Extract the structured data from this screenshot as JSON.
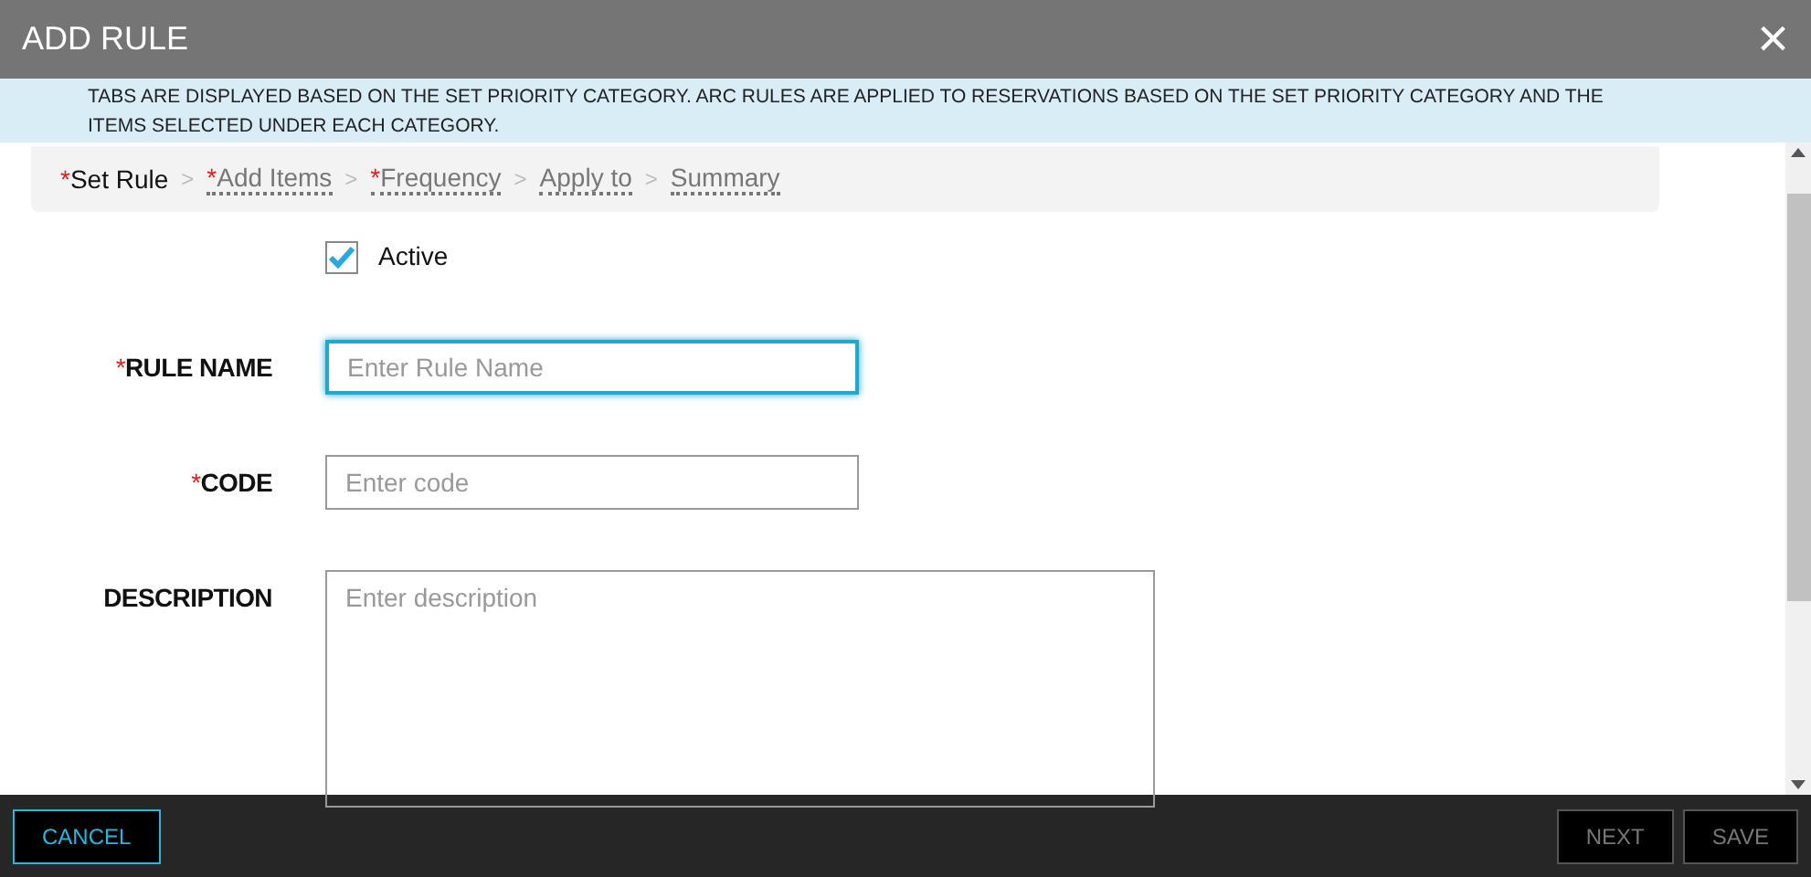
{
  "window": {
    "title": "ADD RULE",
    "close": "×"
  },
  "info": "TABS ARE DISPLAYED BASED ON THE SET PRIORITY CATEGORY. ARC RULES ARE APPLIED TO RESERVATIONS BASED ON THE SET PRIORITY CATEGORY AND THE ITEMS SELECTED UNDER EACH CATEGORY.",
  "steps": [
    {
      "mark": "*",
      "label": "Set Rule",
      "selected": true
    },
    {
      "mark": "*",
      "label": "Add Items",
      "selected": false
    },
    {
      "mark": "*",
      "label": "Frequency",
      "selected": false
    },
    {
      "label": "Apply to",
      "selected": false
    },
    {
      "label": "Summary",
      "selected": false
    }
  ],
  "step_separator": ">",
  "fields": [
    {
      "kind": "checkbox",
      "label": "Active",
      "checked": true
    },
    {
      "kind": "text",
      "mark": "*",
      "label": "RULE NAME",
      "placeholder": "Enter Rule Name",
      "focused": true
    },
    {
      "kind": "text",
      "mark": "*",
      "label": "CODE",
      "placeholder": "Enter code",
      "focused": false
    },
    {
      "kind": "textarea",
      "label": "DESCRIPTION",
      "placeholder": "Enter description"
    }
  ],
  "left_buttons": [
    {
      "label": "CANCEL",
      "disabled": false
    }
  ],
  "right_buttons": [
    {
      "label": "NEXT",
      "disabled": true
    },
    {
      "label": "SAVE",
      "disabled": true
    }
  ]
}
